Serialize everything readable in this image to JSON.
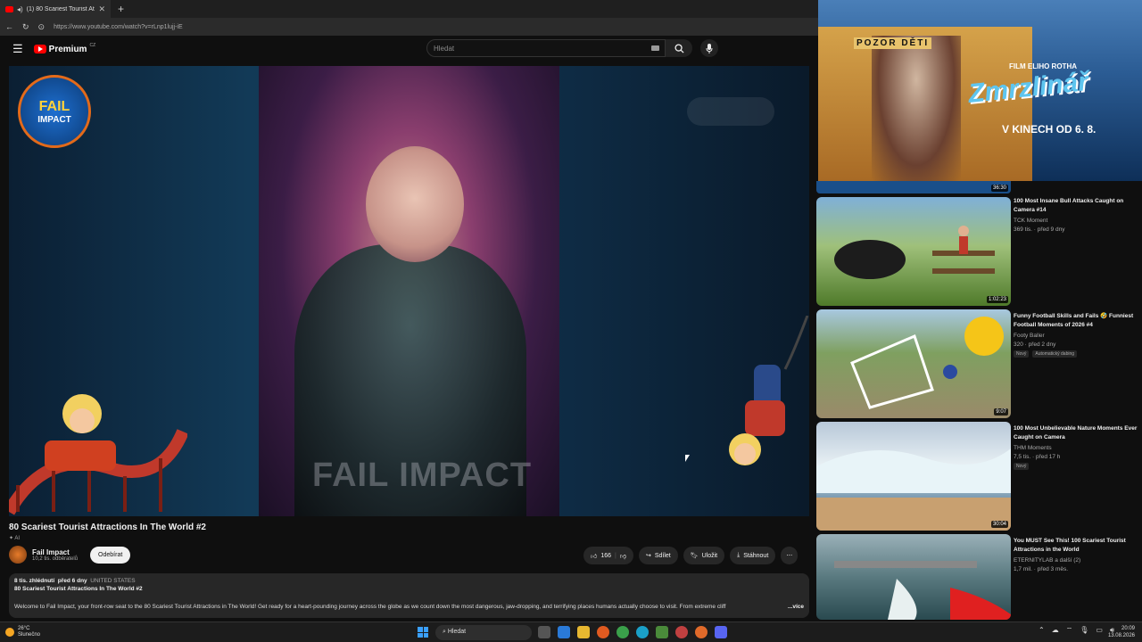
{
  "browser": {
    "tab_title": "(1) 80 Scariest Tourist Attracti",
    "url": "https://www.youtube.com/watch?v=rLnp1lujj-iE"
  },
  "header": {
    "logo_text": "Premium",
    "logo_region": "CZ",
    "search_placeholder": "Hledat"
  },
  "player": {
    "watermark": "FAIL IMPACT",
    "channel_logo_line1": "FAIL",
    "channel_logo_line2": "IMPACT"
  },
  "video": {
    "title": "80 Scariest Tourist Attractions In The World #2",
    "ai_label": "AI",
    "channel_name": "Fail Impact",
    "channel_subs": "10,2 tis. odběratelů",
    "subscribe_label": "Odebírat",
    "likes": "166",
    "share_label": "Sdílet",
    "save_label": "Uložit",
    "download_label": "Stáhnout"
  },
  "description": {
    "views": "8 tis. zhlédnutí",
    "age": "před 6 dny",
    "country": "UNITED STATES",
    "line2": "80 Scariest Tourist Attractions In The World #2",
    "body": "Welcome to Fail Impact, your front-row seat to the 80 Scariest Tourist Attractions in The World! Get ready for a heart-pounding journey across the globe as we count down the most dangerous, jaw-dropping, and terrifying places humans actually choose to visit. From extreme cliff",
    "more": "...více"
  },
  "ad": {
    "sign": "POZOR DĚTI",
    "caption": "FILM ELIHO ROTHA",
    "logo": "Zmrzlinář",
    "date": "V KINECH OD 6. 8."
  },
  "recommendations": [
    {
      "title": "100 Most Insane Bull Attacks Caught on Camera #14",
      "channel": "TCK Moment",
      "stats": "369 tis. · před 9 dny",
      "duration": "1:02:23",
      "badges": []
    },
    {
      "title": "Funny Football Skills and Fails 🤣 Funniest Football Moments of 2026 #4",
      "channel": "Footy Baller",
      "stats": "320 · před 2 dny",
      "duration": "9:07",
      "badges": [
        "Nový",
        "Automatický dabing"
      ]
    },
    {
      "title": "100 Most Unbelievable Nature Moments Ever Caught on Camera",
      "channel": "THM Moments",
      "stats": "7,5 tis. · před 17 h",
      "duration": "30:04",
      "badges": [
        "Nový"
      ]
    },
    {
      "title": "You MUST See This! 100 Scariest Tourist Attractions in the World",
      "channel": "ETERNITYLAB a další (2)",
      "stats": "1,7 mil. · před 3 měs.",
      "duration": "",
      "badges": []
    }
  ],
  "partial_top_duration": "36:30",
  "taskbar": {
    "temp": "26°C",
    "weather": "Slunečno",
    "search": "Hledat",
    "time": "20:09",
    "date": "13.08.2026"
  }
}
